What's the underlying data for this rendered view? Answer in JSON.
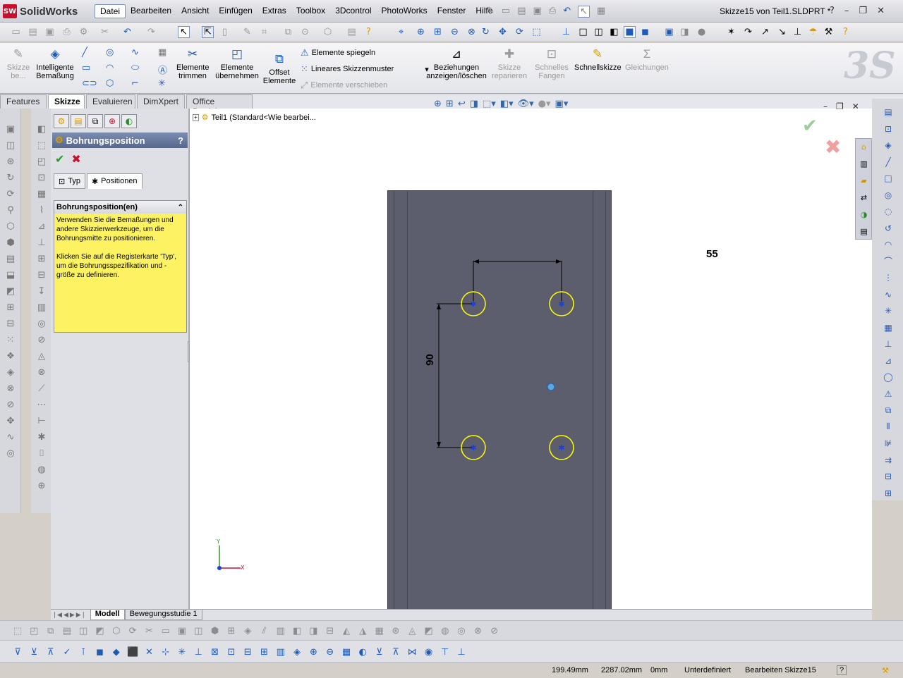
{
  "app": {
    "name": "SolidWorks",
    "logo_text": "SW"
  },
  "menu": [
    "Datei",
    "Bearbeiten",
    "Ansicht",
    "Einfügen",
    "Extras",
    "Toolbox",
    "3Dcontrol",
    "PhotoWorks",
    "Fenster",
    "Hilfe"
  ],
  "window_title": "Skizze15 von Teil1.SLDPRT *",
  "window_controls": {
    "help": "?",
    "minimize": "–",
    "restore": "❐",
    "close": "✕"
  },
  "command_manager": {
    "skizze": "Skizze\nbe...",
    "smart_dim": "Intelligente\nBemaßung",
    "trim": "Elemente\ntrimmen",
    "convert": "Elemente\nübernehmen",
    "offset": "Offset\nElemente",
    "mirror": "Elemente spiegeln",
    "linear_pattern": "Lineares Skizzenmuster",
    "move": "Elemente verschieben",
    "relations": "Beziehungen\nanzeigen/löschen",
    "repair": "Skizze\nreparieren",
    "quick_snaps": "Schnelles\nFangen",
    "rapid_sketch": "Schnellskizze",
    "equations": "Gleichungen"
  },
  "tabs": [
    "Features",
    "Skizze",
    "Evaluieren",
    "DimXpert",
    "Office Produkte"
  ],
  "active_tab": "Skizze",
  "property_manager": {
    "title": "Bohrungsposition",
    "help": "?",
    "ok": "✔",
    "cancel": "✖",
    "tab_type": "Typ",
    "tab_positions": "Positionen",
    "group_title": "Bohrungsposition(en)",
    "message_1": "Verwenden Sie die Bemaßungen und andere Skizzierwerkzeuge, um die Bohrungsmitte zu positionieren.",
    "message_2": "Klicken Sie auf die Registerkarte 'Typ', um die Bohrungsspezifikation und -größe zu definieren."
  },
  "feature_tree": {
    "expand": "+",
    "item": "Teil1  (Standard<Wie bearbei..."
  },
  "dimensions": {
    "horizontal": "55",
    "vertical": "90"
  },
  "triad": {
    "x": "X",
    "y": "Y"
  },
  "bottom_tabs": [
    "Modell",
    "Bewegungsstudie 1"
  ],
  "status": {
    "x": "199.49mm",
    "y": "2287.02mm",
    "z": "0mm",
    "state": "Unterdefiniert",
    "editing": "Bearbeiten Skizze15",
    "help": "?"
  },
  "colors": {
    "accent": "#1e5bb8",
    "part": "#5c5e6e",
    "hole": "#ffff00",
    "hint": "#fcf262"
  }
}
